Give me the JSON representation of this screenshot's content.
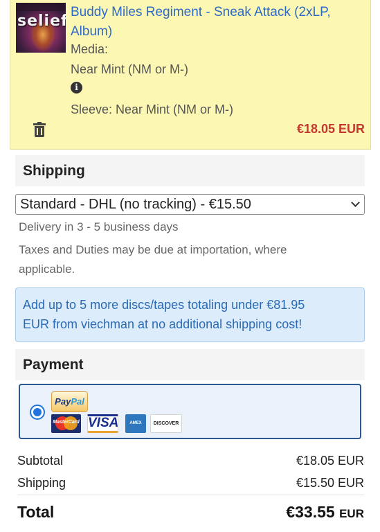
{
  "item": {
    "title": "Buddy Miles Regiment - Sneak Attack (2xLP, Album)",
    "cover_text": "selief",
    "media_label": "Media:",
    "media_condition": "Near Mint (NM or M-)",
    "sleeve_condition": "Sleeve: Near Mint (NM or M-)",
    "price": "€18.05 EUR",
    "info_icon": "info-icon",
    "remove_icon": "trash-icon"
  },
  "shipping": {
    "heading": "Shipping",
    "selected_option": "Standard - DHL (no tracking) - €15.50",
    "delivery_note": "Delivery in 3 - 5 business days",
    "taxes_note_line1": "Taxes and Duties may be due at importation, where",
    "taxes_note_line2": "applicable.",
    "promo_line1": "Add up to 5 more discs/tapes totaling under €81.95",
    "promo_line2": "EUR from viechman at no additional shipping cost!"
  },
  "payment": {
    "heading": "Payment",
    "method": "PayPal",
    "paypal_pay": "Pay",
    "paypal_pal": "Pal",
    "cards": [
      "MasterCard",
      "VISA",
      "AMEX",
      "DISCOVER"
    ]
  },
  "summary": {
    "subtotal_label": "Subtotal",
    "subtotal_value": "€18.05 EUR",
    "shipping_label": "Shipping",
    "shipping_value": "€15.50 EUR",
    "total_label": "Total",
    "total_amount": "€33.55",
    "total_currency": "EUR"
  },
  "colors": {
    "item_background": "#fcf8b4",
    "link_blue": "#2d6ac8",
    "price_red": "#c4392f",
    "info_box": "#dcecfa"
  }
}
